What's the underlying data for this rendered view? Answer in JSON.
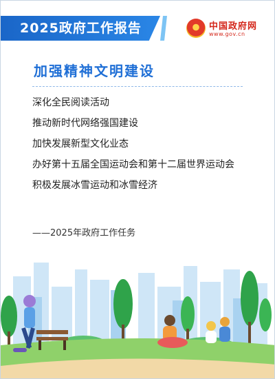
{
  "banner": {
    "title": "2025政府工作报告"
  },
  "logo": {
    "name": "中国政府网",
    "url": "www.gov.cn"
  },
  "heading": "加强精神文明建设",
  "items": [
    "深化全民阅读活动",
    "推动新时代网络强国建设",
    "加快发展新型文化业态",
    "办好第十五届全国运动会和第十二届世界运动会",
    "积极发展冰雪运动和冰雪经济"
  ],
  "source_note": "——2025年政府工作任务",
  "colors": {
    "accent": "#1f6fd6",
    "banner": "#2a86e6",
    "brand_red": "#d4271b"
  }
}
